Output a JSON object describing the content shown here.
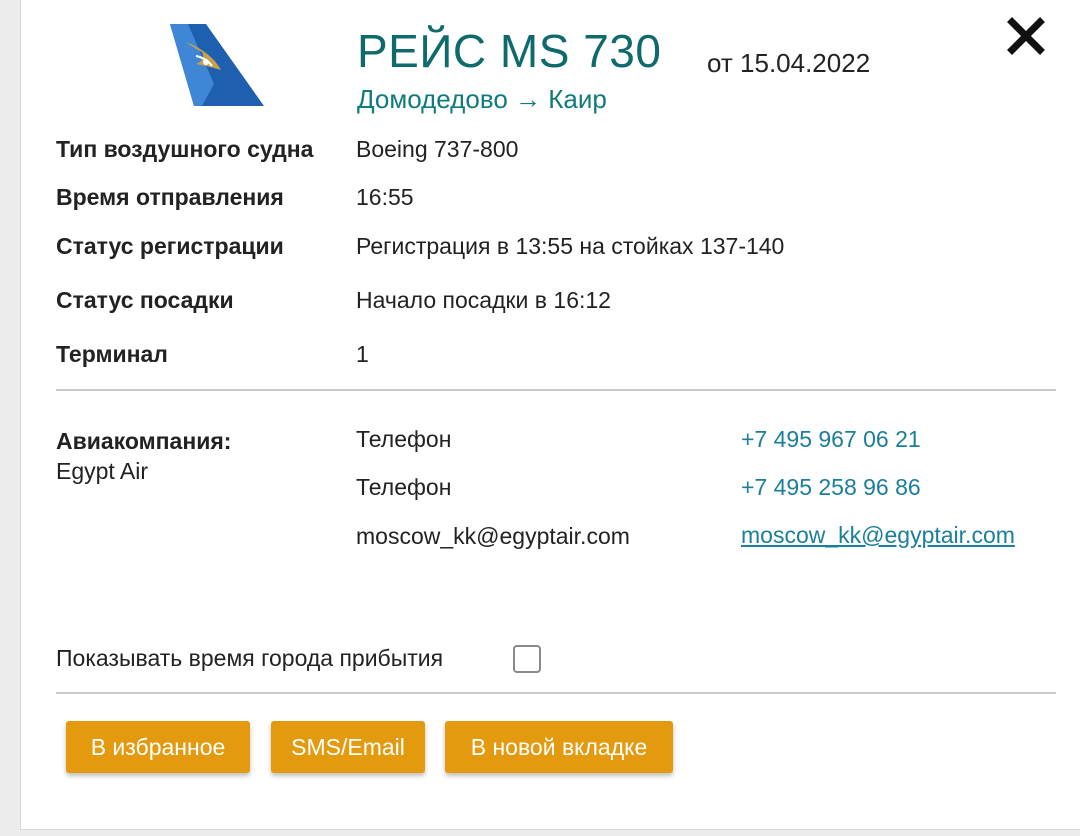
{
  "header": {
    "title": "РЕЙС MS 730",
    "date": "от 15.04.2022",
    "route": "Домодедово → Каир",
    "logo_icon": "egyptair-tail-logo-icon",
    "close_icon": "close-icon"
  },
  "details": [
    {
      "label": "Тип воздушного судна",
      "value": "Boeing 737-800"
    },
    {
      "label": "Время отправления",
      "value": "16:55"
    },
    {
      "label": "Статус регистрации",
      "value": "Регистрация в 13:55 на стойках 137-140"
    },
    {
      "label": "Статус посадки",
      "value": "Начало посадки в 16:12"
    },
    {
      "label": "Терминал",
      "value": "1"
    }
  ],
  "airline": {
    "label": "Авиакомпания:",
    "name": "Egypt Air",
    "contacts": [
      {
        "type": "Телефон",
        "value": "+7 495 967 06 21"
      },
      {
        "type": "Телефон",
        "value": "+7 495 258 96 86"
      },
      {
        "type": "moscow_kk@egyptair.com",
        "value": "moscow_kk@egyptair.com"
      }
    ]
  },
  "options": {
    "show_arrival_time_label": "Показывать время города прибытия",
    "show_arrival_time_checked": false
  },
  "buttons": {
    "favorites": "В избранное",
    "sms_email": "SMS/Email",
    "new_tab": "В новой вкладке"
  },
  "colors": {
    "title": "#0f6b6b",
    "link": "#1a7f9a",
    "button": "#e39a0e",
    "logo_blue": "#1f5fb0",
    "logo_gold": "#c8a24a"
  }
}
